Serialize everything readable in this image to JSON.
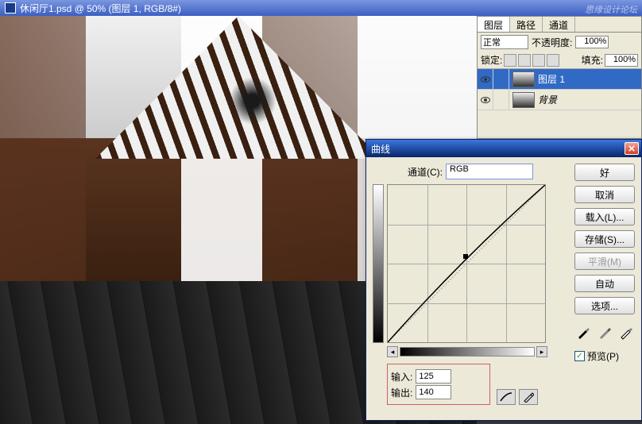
{
  "title_bar": "休闲厅1.psd @ 50% (图层 1, RGB/8#)",
  "watermark": "思缘设计论坛",
  "layers_panel": {
    "tabs": [
      "图层",
      "路径",
      "通道"
    ],
    "blend_mode": "正常",
    "opacity_label": "不透明度:",
    "opacity_value": "100%",
    "lock_label": "锁定:",
    "fill_label": "填充:",
    "fill_value": "100%",
    "layers": [
      {
        "name": "图层 1",
        "visible": true,
        "selected": true
      },
      {
        "name": "背景",
        "visible": true,
        "selected": false
      }
    ]
  },
  "curves_dialog": {
    "title": "曲线",
    "channel_label": "通道(C):",
    "channel_value": "RGB",
    "input_label": "输入:",
    "input_value": "125",
    "output_label": "输出:",
    "output_value": "140",
    "buttons": {
      "ok": "好",
      "cancel": "取消",
      "load": "载入(L)...",
      "save": "存储(S)...",
      "smooth": "平滑(M)",
      "auto": "自动",
      "options": "选项..."
    },
    "preview_label": "预览(P)",
    "preview_checked": true
  }
}
